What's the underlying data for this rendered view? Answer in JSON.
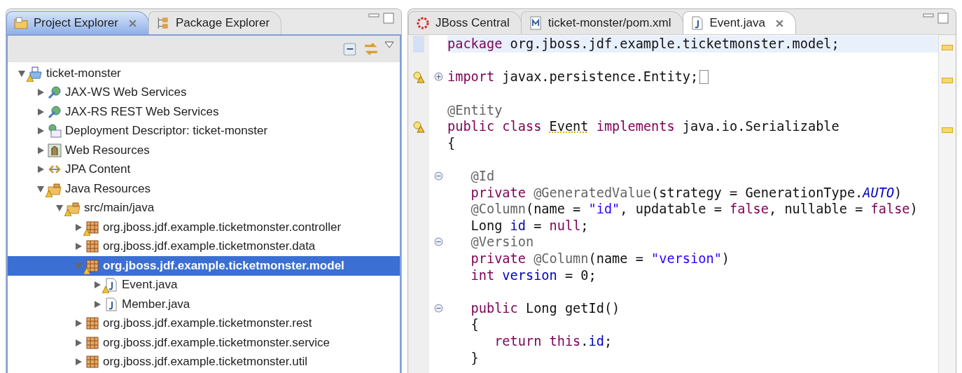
{
  "explorer": {
    "tabs": [
      {
        "label": "Project Explorer",
        "kind": "folder",
        "selected": true,
        "closable": true
      },
      {
        "label": "Package Explorer",
        "kind": "hierarchy",
        "selected": false,
        "closable": false
      }
    ],
    "tree": [
      {
        "label": "ticket-monster",
        "kind": "project",
        "expanded": true,
        "selected": false,
        "warning": true,
        "children": [
          {
            "label": "JAX-WS Web Services",
            "kind": "webservice",
            "expanded": false,
            "selected": false,
            "warning": false
          },
          {
            "label": "JAX-RS REST Web Services",
            "kind": "webservice",
            "expanded": false,
            "selected": false,
            "warning": false
          },
          {
            "label": "Deployment Descriptor: ticket-monster",
            "kind": "descriptor",
            "expanded": false,
            "selected": false,
            "warning": false
          },
          {
            "label": "Web Resources",
            "kind": "webres",
            "expanded": false,
            "selected": false,
            "warning": false
          },
          {
            "label": "JPA Content",
            "kind": "jpa",
            "expanded": false,
            "selected": false,
            "warning": false
          },
          {
            "label": "Java Resources",
            "kind": "sourcefolder",
            "expanded": true,
            "selected": false,
            "warning": true,
            "children": [
              {
                "label": "src/main/java",
                "kind": "sourcefolder",
                "expanded": true,
                "selected": false,
                "warning": true,
                "children": [
                  {
                    "label": "org.jboss.jdf.example.ticketmonster.controller",
                    "kind": "package",
                    "expanded": false,
                    "selected": false,
                    "warning": true
                  },
                  {
                    "label": "org.jboss.jdf.example.ticketmonster.data",
                    "kind": "package",
                    "expanded": false,
                    "selected": false,
                    "warning": false
                  },
                  {
                    "label": "org.jboss.jdf.example.ticketmonster.model",
                    "kind": "package",
                    "expanded": true,
                    "selected": true,
                    "warning": true,
                    "children": [
                      {
                        "label": "Event.java",
                        "kind": "javafile",
                        "expanded": false,
                        "selected": false,
                        "warning": true
                      },
                      {
                        "label": "Member.java",
                        "kind": "javafile",
                        "expanded": false,
                        "selected": false,
                        "warning": false
                      }
                    ]
                  },
                  {
                    "label": "org.jboss.jdf.example.ticketmonster.rest",
                    "kind": "package",
                    "expanded": false,
                    "selected": false,
                    "warning": false
                  },
                  {
                    "label": "org.jboss.jdf.example.ticketmonster.service",
                    "kind": "package",
                    "expanded": false,
                    "selected": false,
                    "warning": false
                  },
                  {
                    "label": "org.jboss.jdf.example.ticketmonster.util",
                    "kind": "package",
                    "expanded": false,
                    "selected": false,
                    "warning": false
                  }
                ]
              }
            ]
          }
        ]
      }
    ]
  },
  "editor": {
    "tabs": [
      {
        "label": "JBoss Central",
        "kind": "jboss",
        "selected": false,
        "closable": false
      },
      {
        "label": "ticket-monster/pom.xml",
        "kind": "maven",
        "selected": false,
        "closable": false
      },
      {
        "label": "Event.java",
        "kind": "javafile",
        "selected": true,
        "closable": true
      }
    ],
    "lines": [
      {
        "kind": "code",
        "current": true,
        "tokens": [
          {
            "text": "package",
            "kind": "kw"
          },
          {
            "text": " org.jboss.jdf.example.ticketmonster.model;",
            "kind": "txt"
          }
        ]
      },
      {
        "kind": "blank"
      },
      {
        "kind": "code",
        "warning": true,
        "folded": true,
        "tokens": [
          {
            "text": "import",
            "kind": "kw"
          },
          {
            "text": " javax.persistence.Entity;",
            "kind": "txt"
          }
        ]
      },
      {
        "kind": "blank"
      },
      {
        "kind": "code",
        "tokens": [
          {
            "text": "@Entity",
            "kind": "ann"
          }
        ]
      },
      {
        "kind": "code",
        "warning": true,
        "tokens": [
          {
            "text": "public class ",
            "kind": "kw"
          },
          {
            "text": "Event",
            "kind": "warn"
          },
          {
            "text": " implements",
            "kind": "kw"
          },
          {
            "text": " java.io.Serializable",
            "kind": "txt"
          }
        ]
      },
      {
        "kind": "code",
        "tokens": [
          {
            "text": "{",
            "kind": "txt"
          }
        ],
        "children": [
          {
            "kind": "blank"
          },
          {
            "kind": "code",
            "folded": false,
            "tokens": [
              {
                "text": "@Id",
                "kind": "ann"
              }
            ]
          },
          {
            "kind": "code",
            "tokens": [
              {
                "text": "private ",
                "kind": "kw"
              },
              {
                "text": "@GeneratedValue",
                "kind": "ann"
              },
              {
                "text": "(strategy = GenerationType.",
                "kind": "txt"
              },
              {
                "text": "AUTO",
                "kind": "const"
              },
              {
                "text": ")",
                "kind": "txt"
              }
            ]
          },
          {
            "kind": "code",
            "tokens": [
              {
                "text": "@Column",
                "kind": "ann"
              },
              {
                "text": "(name = ",
                "kind": "txt"
              },
              {
                "text": "\"id\"",
                "kind": "str"
              },
              {
                "text": ", updatable = ",
                "kind": "txt"
              },
              {
                "text": "false",
                "kind": "kw"
              },
              {
                "text": ", nullable = ",
                "kind": "txt"
              },
              {
                "text": "false",
                "kind": "kw"
              },
              {
                "text": ")",
                "kind": "txt"
              }
            ]
          },
          {
            "kind": "code",
            "tokens": [
              {
                "text": "Long ",
                "kind": "txt"
              },
              {
                "text": "id",
                "kind": "fld"
              },
              {
                "text": " = ",
                "kind": "txt"
              },
              {
                "text": "null",
                "kind": "kw"
              },
              {
                "text": ";",
                "kind": "txt"
              }
            ]
          },
          {
            "kind": "code",
            "folded": false,
            "tokens": [
              {
                "text": "@Version",
                "kind": "ann"
              }
            ]
          },
          {
            "kind": "code",
            "tokens": [
              {
                "text": "private ",
                "kind": "kw"
              },
              {
                "text": "@Column",
                "kind": "ann"
              },
              {
                "text": "(name = ",
                "kind": "txt"
              },
              {
                "text": "\"version\"",
                "kind": "str"
              },
              {
                "text": ")",
                "kind": "txt"
              }
            ]
          },
          {
            "kind": "code",
            "tokens": [
              {
                "text": "int ",
                "kind": "kw"
              },
              {
                "text": "version",
                "kind": "fld"
              },
              {
                "text": " = 0;",
                "kind": "txt"
              }
            ]
          },
          {
            "kind": "blank"
          },
          {
            "kind": "code",
            "folded": false,
            "tokens": [
              {
                "text": "public",
                "kind": "kw"
              },
              {
                "text": " Long getId()",
                "kind": "txt"
              }
            ]
          },
          {
            "kind": "code",
            "tokens": [
              {
                "text": "{",
                "kind": "txt"
              }
            ],
            "children": [
              {
                "kind": "code",
                "tokens": [
                  {
                    "text": "return ",
                    "kind": "kw"
                  },
                  {
                    "text": "this",
                    "kind": "kw"
                  },
                  {
                    "text": ".",
                    "kind": "txt"
                  },
                  {
                    "text": "id",
                    "kind": "fld"
                  },
                  {
                    "text": ";",
                    "kind": "txt"
                  }
                ]
              }
            ]
          },
          {
            "kind": "code",
            "tokens": [
              {
                "text": "}",
                "kind": "txt"
              }
            ]
          }
        ]
      }
    ]
  }
}
